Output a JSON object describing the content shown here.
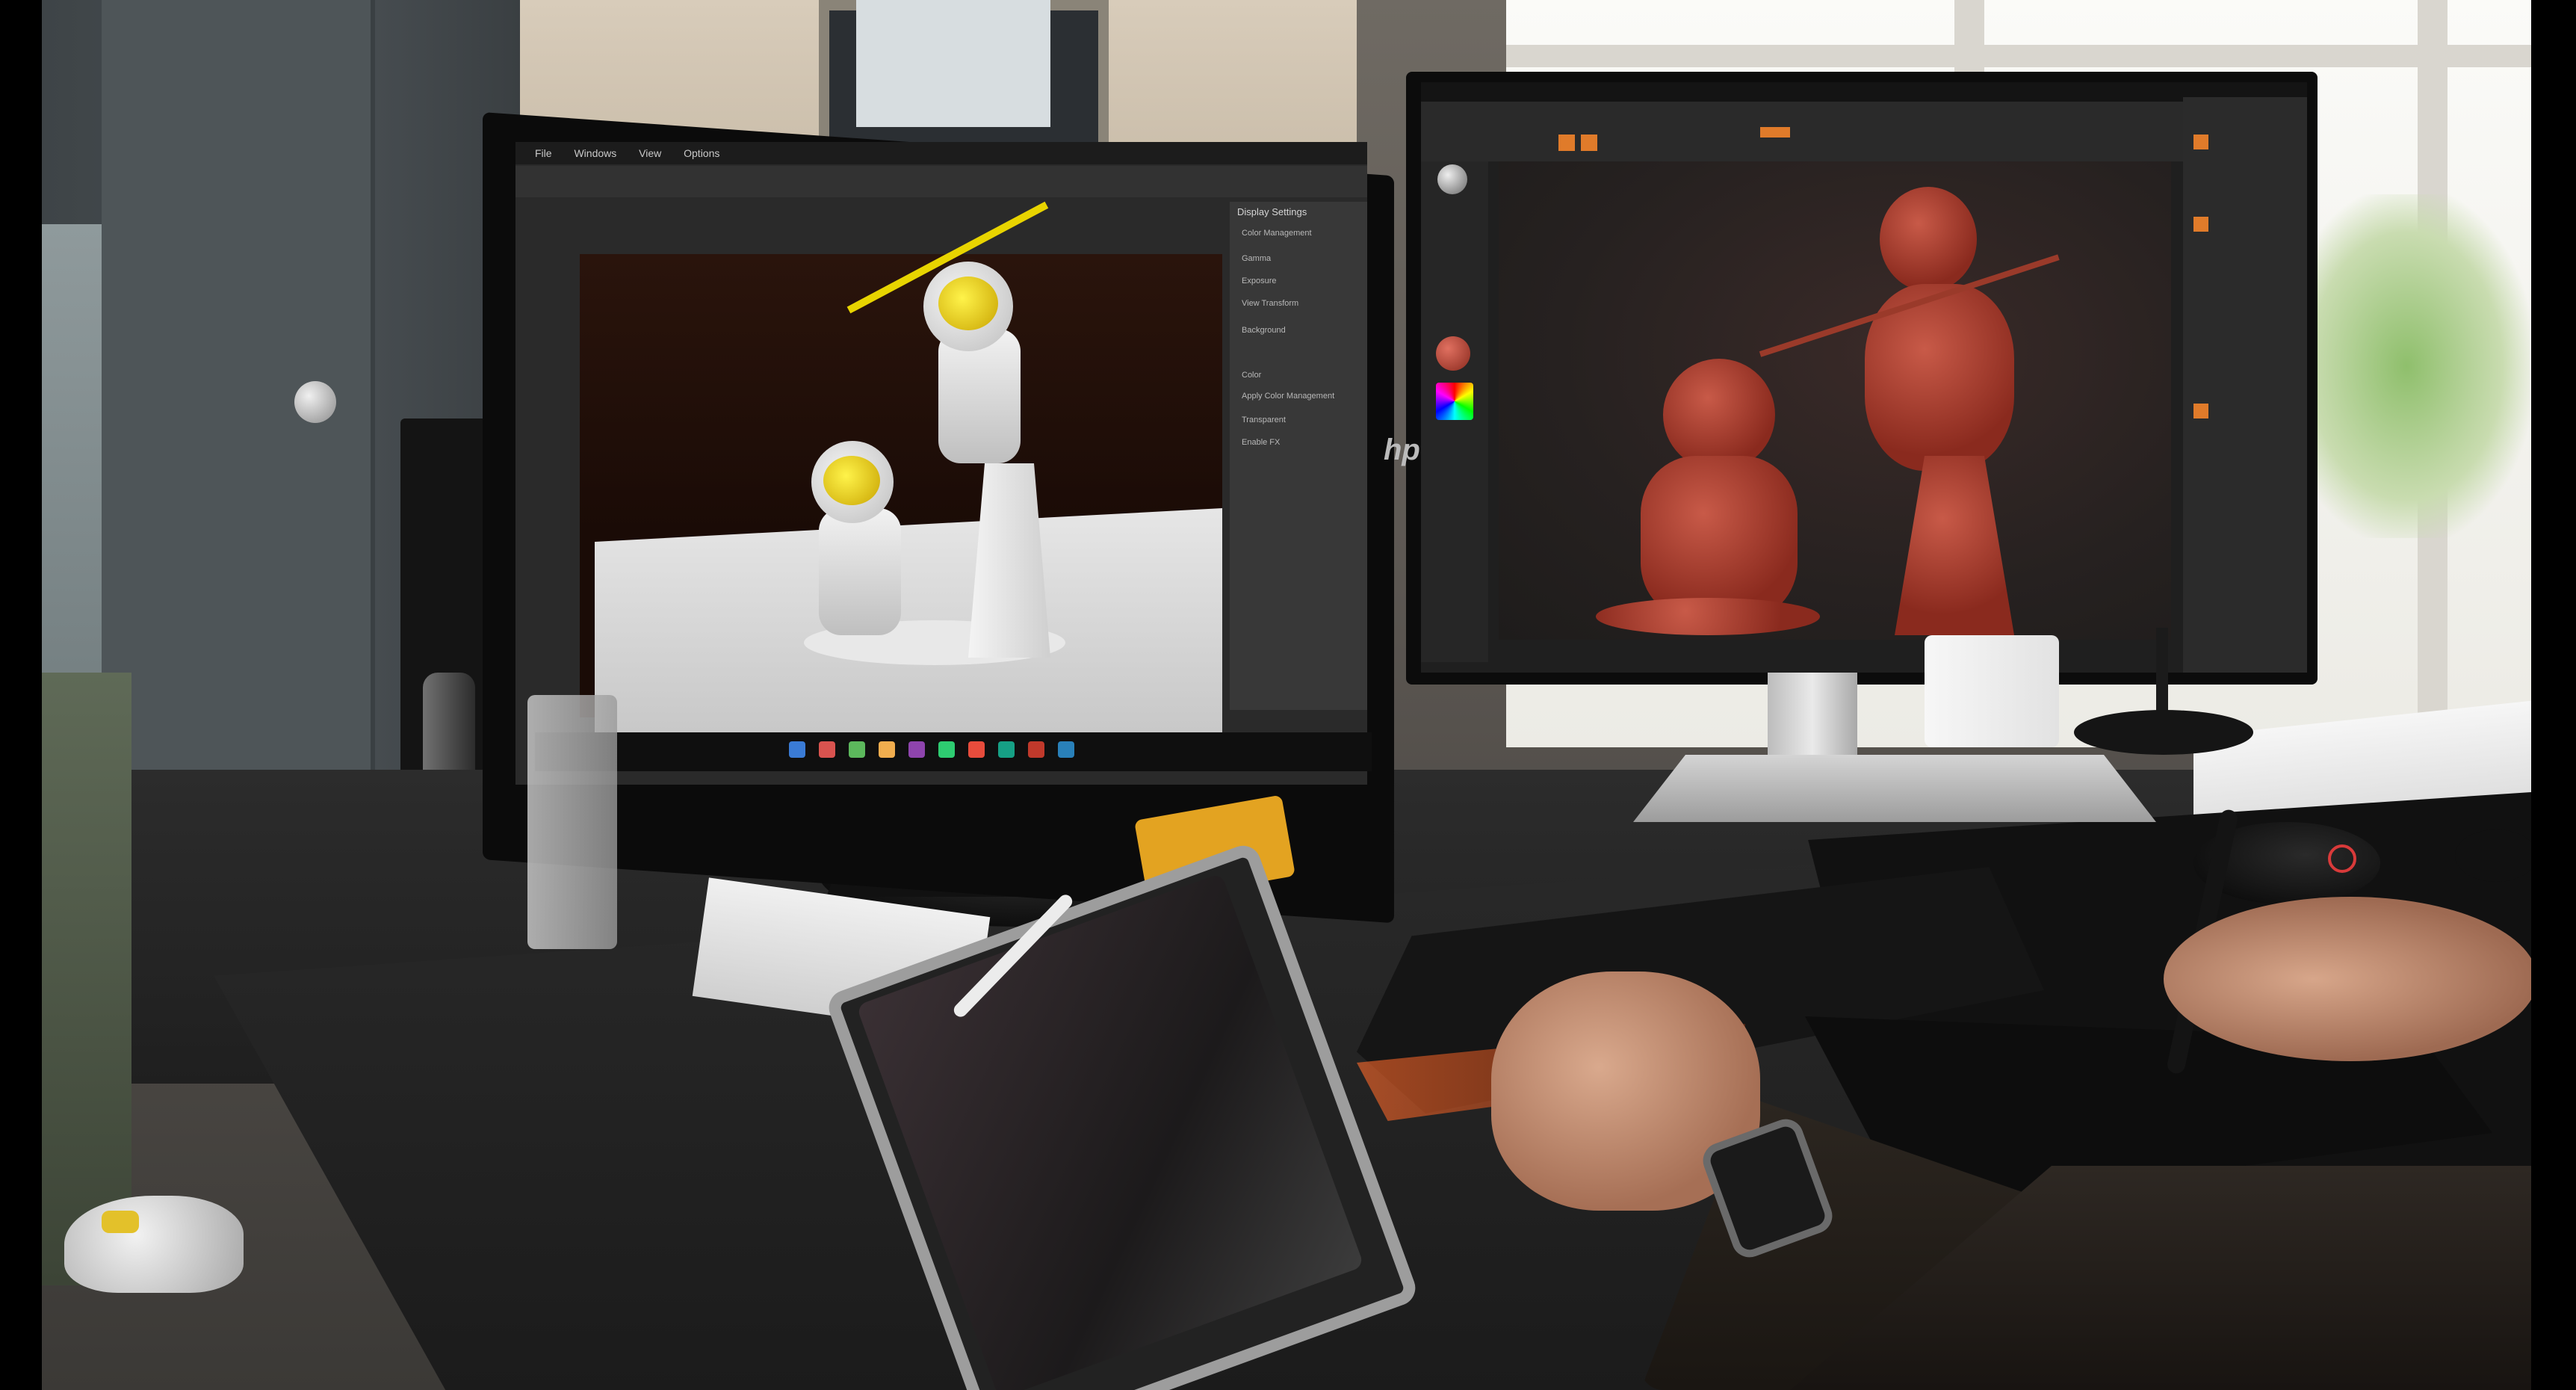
{
  "scene": {
    "description_tag": "natural-image",
    "left_monitor": {
      "menu_items": [
        "File",
        "Windows",
        "View",
        "Options"
      ],
      "panel_title": "Display Settings",
      "panel_labels": [
        "Color Management",
        "Gamma",
        "Exposure",
        "View Transform",
        "Background",
        "Color",
        "Apply Color Management",
        "Transparent",
        "Enable FX"
      ]
    },
    "right_monitor": {
      "brand": "hp"
    },
    "colors": {
      "clay": "#b5453a",
      "visor": "#f1d81a",
      "keyboard_backlight": "#ff6a2a",
      "zbrush_orange": "#e07b2a"
    }
  }
}
